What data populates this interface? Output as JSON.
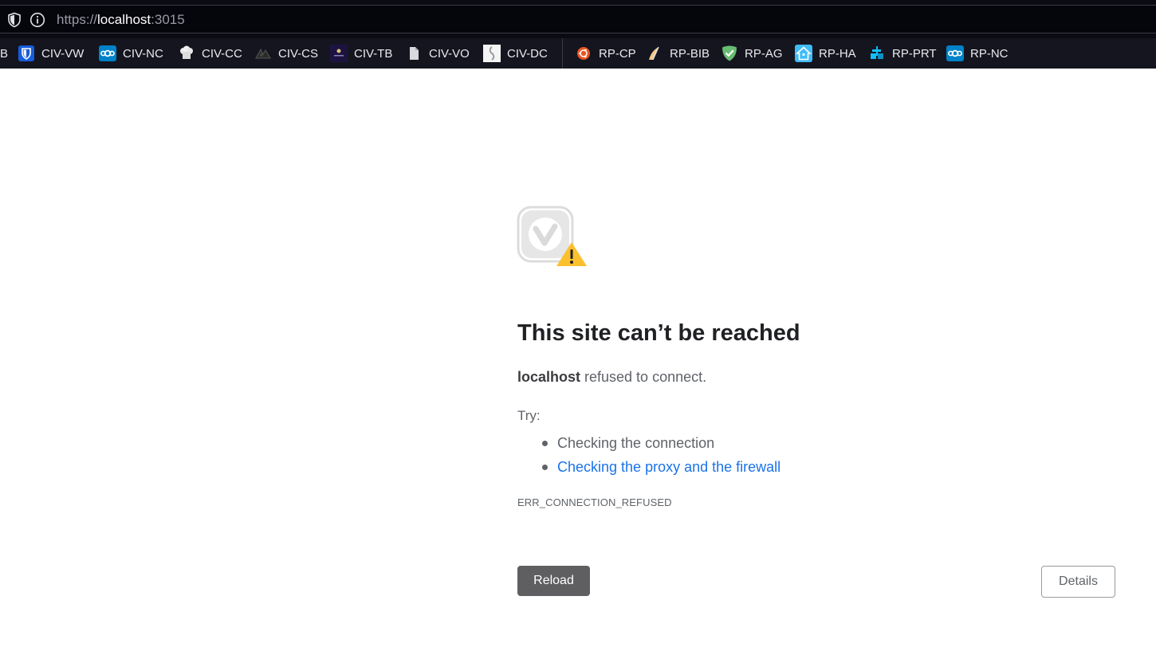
{
  "addressbar": {
    "url_scheme": "https://",
    "url_host": "localhost",
    "url_port": ":3015",
    "icons": [
      "shield-icon",
      "info-icon"
    ]
  },
  "bookmarks": {
    "left_edge_partial": "B",
    "items": [
      {
        "label": "CIV-VW",
        "icon": "bitwarden-icon"
      },
      {
        "label": "CIV-NC",
        "icon": "nextcloud-icon"
      },
      {
        "label": "CIV-CC",
        "icon": "chef-hat-icon"
      },
      {
        "label": "CIV-CS",
        "icon": "dark-logo-icon"
      },
      {
        "label": "CIV-TB",
        "icon": "purple-app-icon"
      },
      {
        "label": "CIV-VO",
        "icon": "document-icon"
      },
      {
        "label": "CIV-DC",
        "icon": "white-app-icon"
      },
      {
        "label": "RP-CP",
        "icon": "ubuntu-icon"
      },
      {
        "label": "RP-BIB",
        "icon": "bird-icon"
      },
      {
        "label": "RP-AG",
        "icon": "adguard-shield-icon"
      },
      {
        "label": "RP-HA",
        "icon": "home-assistant-icon"
      },
      {
        "label": "RP-PRT",
        "icon": "portainer-icon"
      },
      {
        "label": "RP-NC",
        "icon": "nextcloud-icon"
      }
    ]
  },
  "error": {
    "title": "This site can’t be reached",
    "host": "localhost",
    "message": " refused to connect.",
    "try_label": "Try:",
    "suggestions": [
      {
        "text": "Checking the connection",
        "link": false
      },
      {
        "text": "Checking the proxy and the firewall",
        "link": true
      }
    ],
    "code": "ERR_CONNECTION_REFUSED",
    "reload_label": "Reload",
    "details_label": "Details"
  },
  "colors": {
    "link": "#1a73e8",
    "warning": "#fbc02d",
    "reload_bg": "#5f5f62"
  }
}
